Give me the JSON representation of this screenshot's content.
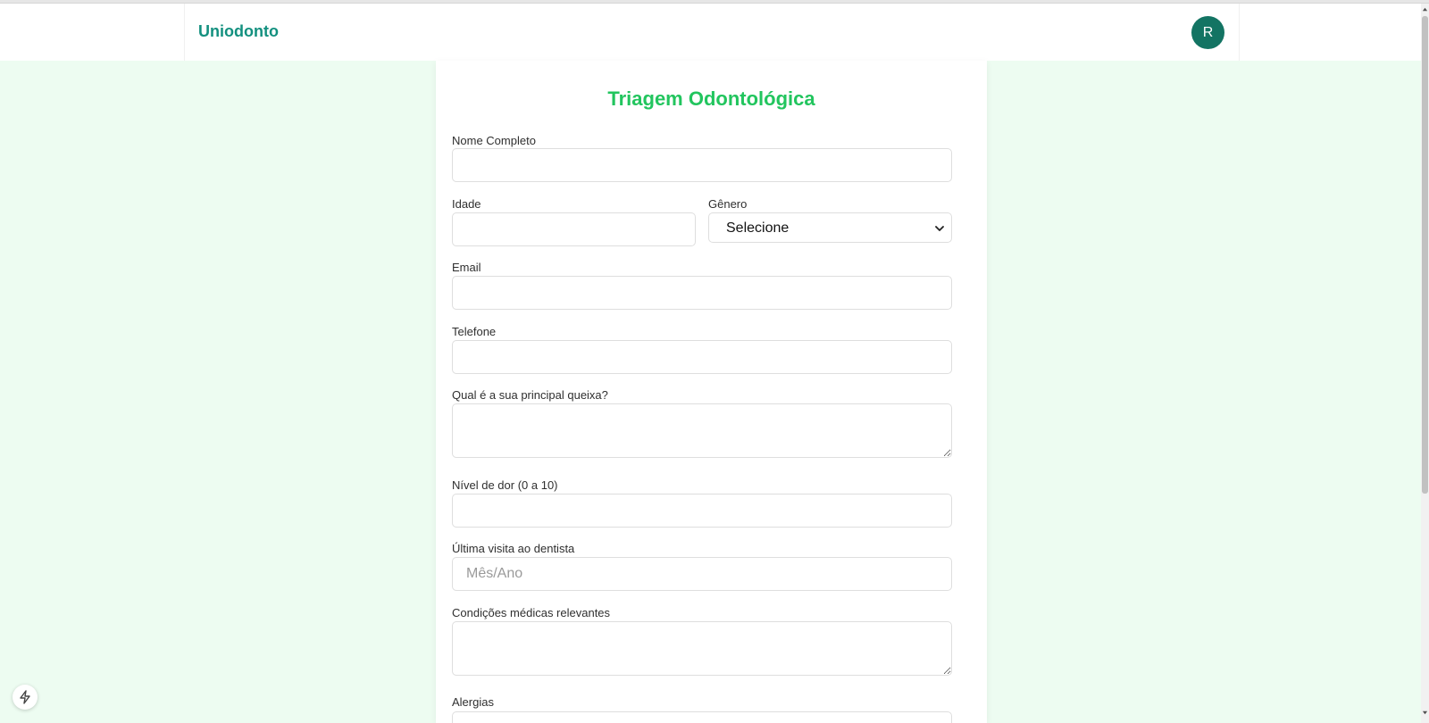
{
  "header": {
    "brand": "Uniodonto",
    "avatar_initial": "R"
  },
  "form": {
    "title": "Triagem Odontológica",
    "fields": {
      "nome": {
        "label": "Nome Completo",
        "value": ""
      },
      "idade": {
        "label": "Idade",
        "value": ""
      },
      "genero": {
        "label": "Gênero",
        "selected": "Selecione"
      },
      "email": {
        "label": "Email",
        "value": ""
      },
      "telefone": {
        "label": "Telefone",
        "value": ""
      },
      "queixa": {
        "label": "Qual é a sua principal queixa?",
        "value": ""
      },
      "dor": {
        "label": "Nível de dor (0 a 10)",
        "value": ""
      },
      "ultima_visita": {
        "label": "Última visita ao dentista",
        "placeholder": "Mês/Ano",
        "value": ""
      },
      "condicoes": {
        "label": "Condições médicas relevantes",
        "value": ""
      },
      "alergias": {
        "label": "Alergias",
        "value": ""
      }
    }
  },
  "icons": {
    "avatar": "user-avatar",
    "select": "chevron-down-icon",
    "dev_badge": "lightning-icon"
  },
  "colors": {
    "brand": "#13907f",
    "title": "#22c55e",
    "avatar_bg": "#137463",
    "page_bg": "#edfcf1"
  }
}
